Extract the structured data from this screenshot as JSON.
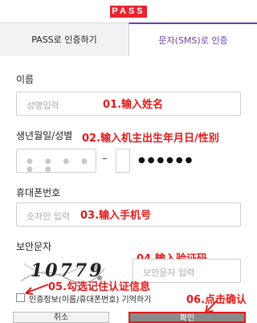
{
  "header": {
    "logo_text": "PASS"
  },
  "tabs": [
    {
      "label": "PASS로 인증하기",
      "active": false
    },
    {
      "label": "문자(SMS)로 인증",
      "active": true
    }
  ],
  "form": {
    "name": {
      "label": "이름",
      "placeholder": "성명입력"
    },
    "birth": {
      "label": "생년월일/성별",
      "separator": "–",
      "birth_dots": "● ● ● ● ● ●",
      "gender_dots": "●●●●●●"
    },
    "phone": {
      "label": "휴대폰번호",
      "placeholder": "숫자만 입력"
    },
    "captcha": {
      "label": "보안문자",
      "image_text": "10779",
      "placeholder": "보안문자 입력"
    },
    "remember_label": "인증정보(이름/휴대폰번호) 기억하기"
  },
  "buttons": {
    "cancel": "취소",
    "confirm": "확인"
  },
  "annotations": {
    "a1": "01.输入姓名",
    "a2": "02.输入机主出生年月日/性别",
    "a3": "03.输入手机号",
    "a4": "04.输入验证码",
    "a5": "05.勾选记住认证信息",
    "a6": "06.点击确认"
  },
  "colors": {
    "brand": "#e8242f",
    "active_tab": "#6a3ea5",
    "annotation": "#e11a1a"
  }
}
